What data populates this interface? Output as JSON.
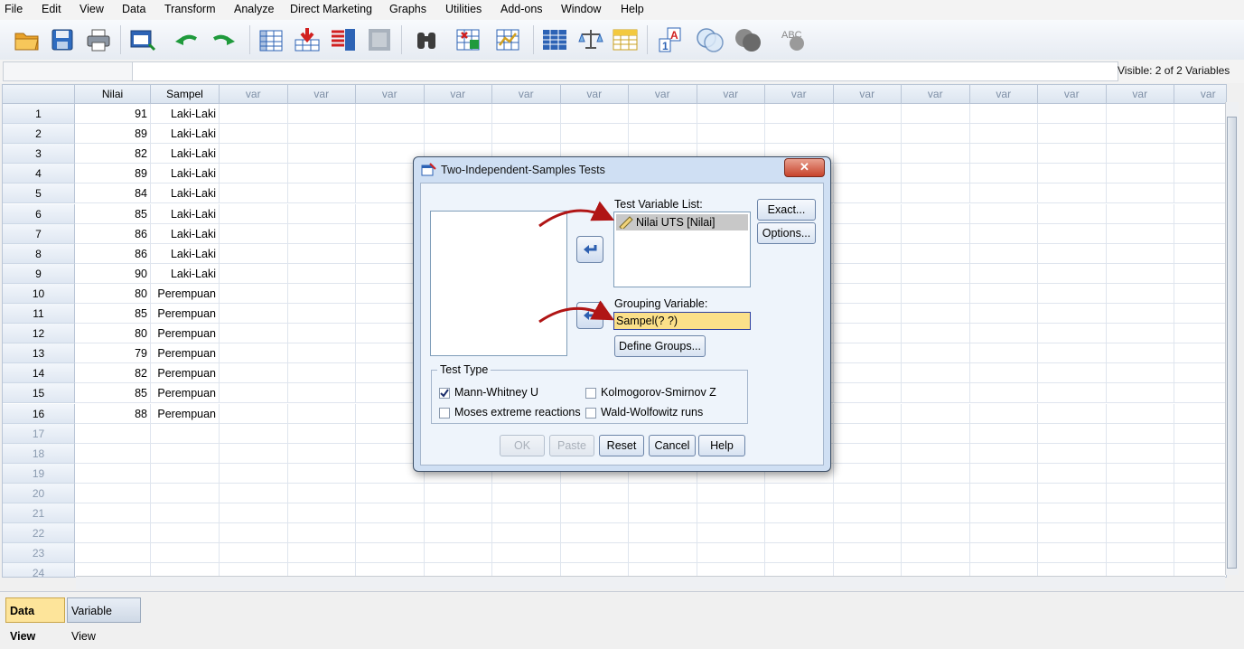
{
  "menu": [
    "File",
    "Edit",
    "View",
    "Data",
    "Transform",
    "Analyze",
    "Direct Marketing",
    "Graphs",
    "Utilities",
    "Add-ons",
    "Window",
    "Help"
  ],
  "toolbar_icons": [
    "open-icon",
    "save-icon",
    "print-icon",
    "dialog-recall-icon",
    "undo-icon",
    "redo-icon",
    "goto-case-icon",
    "goto-variable-icon",
    "variables-icon",
    "run-descriptives-icon",
    "find-icon",
    "insert-cases-icon",
    "insert-variable-icon",
    "split-file-icon",
    "weight-cases-icon",
    "select-cases-icon",
    "value-labels-icon",
    "use-variable-sets-icon",
    "show-all-variables-icon",
    "spell-check-icon"
  ],
  "visible_label": "Visible: 2 of 2 Variables",
  "grid": {
    "columns": [
      "Nilai",
      "Sampel",
      "var",
      "var",
      "var",
      "var",
      "var",
      "var",
      "var",
      "var",
      "var",
      "var",
      "var",
      "var",
      "var",
      "var",
      "var"
    ],
    "row_numbers": [
      "1",
      "2",
      "3",
      "4",
      "5",
      "6",
      "7",
      "8",
      "9",
      "10",
      "11",
      "12",
      "13",
      "14",
      "15",
      "16",
      "17",
      "18",
      "19",
      "20",
      "21",
      "22",
      "23",
      "24"
    ],
    "rows": [
      [
        "91",
        "Laki-Laki"
      ],
      [
        "89",
        "Laki-Laki"
      ],
      [
        "82",
        "Laki-Laki"
      ],
      [
        "89",
        "Laki-Laki"
      ],
      [
        "84",
        "Laki-Laki"
      ],
      [
        "85",
        "Laki-Laki"
      ],
      [
        "86",
        "Laki-Laki"
      ],
      [
        "86",
        "Laki-Laki"
      ],
      [
        "90",
        "Laki-Laki"
      ],
      [
        "80",
        "Perempuan"
      ],
      [
        "85",
        "Perempuan"
      ],
      [
        "80",
        "Perempuan"
      ],
      [
        "79",
        "Perempuan"
      ],
      [
        "82",
        "Perempuan"
      ],
      [
        "85",
        "Perempuan"
      ],
      [
        "88",
        "Perempuan"
      ]
    ]
  },
  "tabs": {
    "data_view": "Data View",
    "variable_view": "Variable View"
  },
  "dialog": {
    "title": "Two-Independent-Samples Tests",
    "test_variable_label": "Test Variable List:",
    "test_variable_item": "Nilai UTS [Nilai]",
    "grouping_label": "Grouping Variable:",
    "grouping_value": "Sampel(? ?)",
    "define_groups": "Define Groups...",
    "exact": "Exact...",
    "options": "Options...",
    "test_type_label": "Test Type",
    "tests": {
      "mann_whitney": {
        "label": "Mann-Whitney U",
        "checked": true
      },
      "kolmogorov": {
        "label": "Kolmogorov-Smirnov Z",
        "checked": false
      },
      "moses": {
        "label": "Moses extreme reactions",
        "checked": false
      },
      "wald": {
        "label": "Wald-Wolfowitz runs",
        "checked": false
      }
    },
    "buttons": {
      "ok": "OK",
      "paste": "Paste",
      "reset": "Reset",
      "cancel": "Cancel",
      "help": "Help"
    }
  },
  "colors": {
    "annotation_arrow": "#b01515",
    "active_tab": "#fde49a",
    "grouping_field": "#fbe089"
  }
}
